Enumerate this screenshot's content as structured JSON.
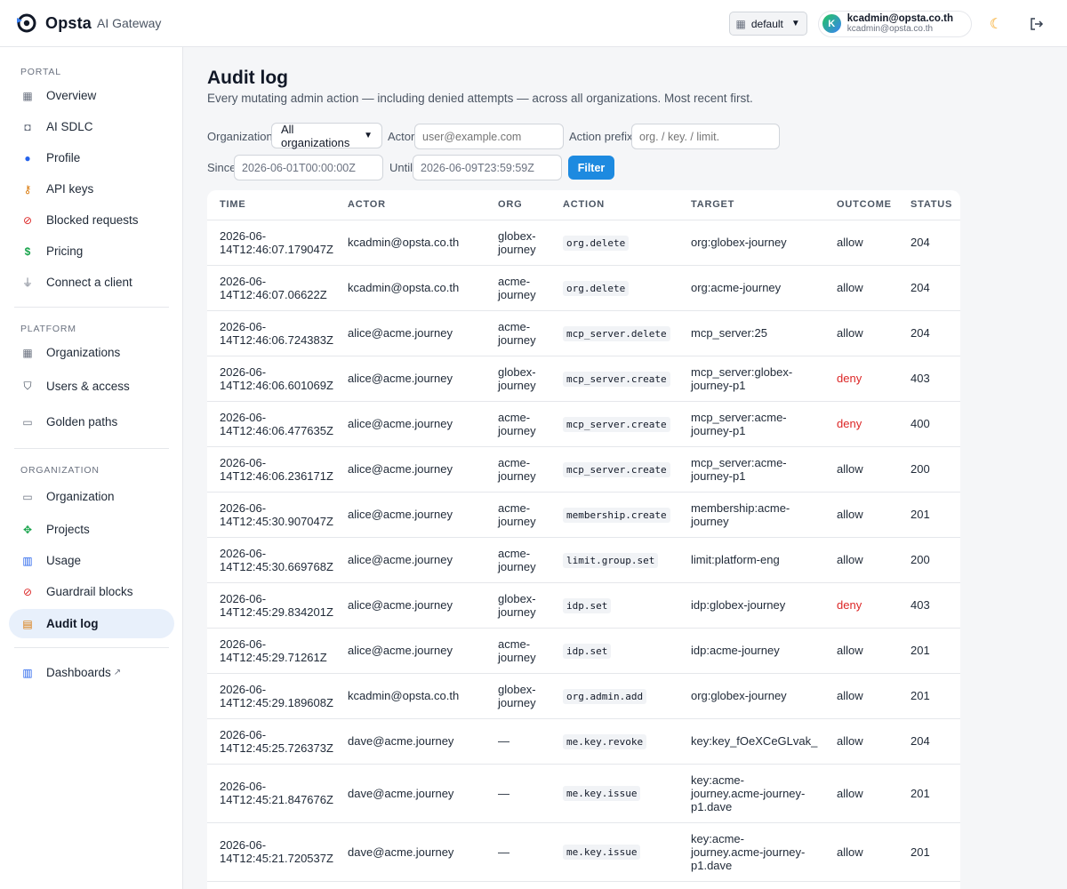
{
  "header": {
    "brand_name": "Opsta",
    "brand_sub": "AI Gateway",
    "org_switcher": "default",
    "user_name": "kcadmin@opsta.co.th",
    "user_email": "kcadmin@opsta.co.th",
    "avatar_letter": "K"
  },
  "sidebar": {
    "portal_title": "PORTAL",
    "portal": [
      {
        "label": "Overview",
        "icon": "grid-icon"
      },
      {
        "label": "AI SDLC",
        "icon": "robot-icon"
      },
      {
        "label": "Profile",
        "icon": "person-icon"
      },
      {
        "label": "API keys",
        "icon": "key-icon"
      },
      {
        "label": "Blocked requests",
        "icon": "prohibited-icon"
      },
      {
        "label": "Pricing",
        "icon": "dollar-icon"
      },
      {
        "label": "Connect a client",
        "icon": "plug-icon"
      }
    ],
    "platform_title": "PLATFORM",
    "platform": [
      {
        "label": "Organizations",
        "icon": "building-icon"
      },
      {
        "label": "Users & access",
        "icon": "shield-icon"
      },
      {
        "label": "Golden paths",
        "icon": "map-icon"
      }
    ],
    "organization_title": "ORGANIZATION",
    "organization": [
      {
        "label": "Organization",
        "icon": "window-icon"
      },
      {
        "label": "Projects",
        "icon": "puzzle-icon"
      },
      {
        "label": "Usage",
        "icon": "bar-chart-icon"
      },
      {
        "label": "Guardrail blocks",
        "icon": "prohibited-icon"
      },
      {
        "label": "Audit log",
        "icon": "scroll-icon"
      }
    ],
    "dashboards": {
      "label": "Dashboards",
      "ext": "↗",
      "icon": "bar-chart-icon"
    }
  },
  "main": {
    "title": "Audit log",
    "subtitle": "Every mutating admin action — including denied attempts — across all organizations. Most recent first.",
    "filters": {
      "org_label": "Organization",
      "org_value": "All organizations",
      "actor_label": "Actor",
      "actor_placeholder": "user@example.com",
      "prefix_label": "Action prefix",
      "prefix_placeholder": "org. / key. / limit.",
      "since_label": "Since",
      "since_value": "2026-06-01T00:00:00Z",
      "until_label": "Until",
      "until_value": "2026-06-09T23:59:59Z",
      "filter_button": "Filter"
    },
    "columns": [
      "TIME",
      "ACTOR",
      "ORG",
      "ACTION",
      "TARGET",
      "OUTCOME",
      "STATUS"
    ],
    "rows": [
      {
        "time1": "2026-06-",
        "time2": "14T12:46:07.179047Z",
        "actor": "kcadmin@opsta.co.th",
        "org1": "globex-",
        "org2": "journey",
        "action": "org.delete",
        "target": [
          "org:globex-journey"
        ],
        "outcome": "allow",
        "status": "204"
      },
      {
        "time1": "2026-06-",
        "time2": "14T12:46:07.06622Z",
        "actor": "kcadmin@opsta.co.th",
        "org1": "acme-",
        "org2": "journey",
        "action": "org.delete",
        "target": [
          "org:acme-journey"
        ],
        "outcome": "allow",
        "status": "204"
      },
      {
        "time1": "2026-06-",
        "time2": "14T12:46:06.724383Z",
        "actor": "alice@acme.journey",
        "org1": "acme-",
        "org2": "journey",
        "action": "mcp_server.delete",
        "target": [
          "mcp_server:25"
        ],
        "outcome": "allow",
        "status": "204"
      },
      {
        "time1": "2026-06-",
        "time2": "14T12:46:06.601069Z",
        "actor": "alice@acme.journey",
        "org1": "globex-",
        "org2": "journey",
        "action": "mcp_server.create",
        "target": [
          "mcp_server:globex-",
          "journey-p1"
        ],
        "outcome": "deny",
        "status": "403"
      },
      {
        "time1": "2026-06-",
        "time2": "14T12:46:06.477635Z",
        "actor": "alice@acme.journey",
        "org1": "acme-",
        "org2": "journey",
        "action": "mcp_server.create",
        "target": [
          "mcp_server:acme-",
          "journey-p1"
        ],
        "outcome": "deny",
        "status": "400"
      },
      {
        "time1": "2026-06-",
        "time2": "14T12:46:06.236171Z",
        "actor": "alice@acme.journey",
        "org1": "acme-",
        "org2": "journey",
        "action": "mcp_server.create",
        "target": [
          "mcp_server:acme-",
          "journey-p1"
        ],
        "outcome": "allow",
        "status": "200"
      },
      {
        "time1": "2026-06-",
        "time2": "14T12:45:30.907047Z",
        "actor": "alice@acme.journey",
        "org1": "acme-",
        "org2": "journey",
        "action": "membership.create",
        "target": [
          "membership:acme-",
          "journey"
        ],
        "outcome": "allow",
        "status": "201"
      },
      {
        "time1": "2026-06-",
        "time2": "14T12:45:30.669768Z",
        "actor": "alice@acme.journey",
        "org1": "acme-",
        "org2": "journey",
        "action": "limit.group.set",
        "target": [
          "limit:platform-eng"
        ],
        "outcome": "allow",
        "status": "200"
      },
      {
        "time1": "2026-06-",
        "time2": "14T12:45:29.834201Z",
        "actor": "alice@acme.journey",
        "org1": "globex-",
        "org2": "journey",
        "action": "idp.set",
        "target": [
          "idp:globex-journey"
        ],
        "outcome": "deny",
        "status": "403"
      },
      {
        "time1": "2026-06-",
        "time2": "14T12:45:29.71261Z",
        "actor": "alice@acme.journey",
        "org1": "acme-",
        "org2": "journey",
        "action": "idp.set",
        "target": [
          "idp:acme-journey"
        ],
        "outcome": "allow",
        "status": "201"
      },
      {
        "time1": "2026-06-",
        "time2": "14T12:45:29.189608Z",
        "actor": "kcadmin@opsta.co.th",
        "org1": "globex-",
        "org2": "journey",
        "action": "org.admin.add",
        "target": [
          "org:globex-journey"
        ],
        "outcome": "allow",
        "status": "201"
      },
      {
        "time1": "2026-06-",
        "time2": "14T12:45:25.726373Z",
        "actor": "dave@acme.journey",
        "org1": "—",
        "org2": "",
        "action": "me.key.revoke",
        "target": [
          "key:key_fOeXCeGLvak_"
        ],
        "outcome": "allow",
        "status": "204"
      },
      {
        "time1": "2026-06-",
        "time2": "14T12:45:21.847676Z",
        "actor": "dave@acme.journey",
        "org1": "—",
        "org2": "",
        "action": "me.key.issue",
        "target": [
          "key:acme-",
          "journey.acme-journey-",
          "p1.dave"
        ],
        "outcome": "allow",
        "status": "201"
      },
      {
        "time1": "2026-06-",
        "time2": "14T12:45:21.720537Z",
        "actor": "dave@acme.journey",
        "org1": "—",
        "org2": "",
        "action": "me.key.issue",
        "target": [
          "key:acme-",
          "journey.acme-journey-",
          "p1.dave"
        ],
        "outcome": "allow",
        "status": "201"
      }
    ]
  },
  "colors": {
    "accent": "#1d8ae0",
    "deny": "#dc2626",
    "active_nav": "#e8f0fb"
  }
}
